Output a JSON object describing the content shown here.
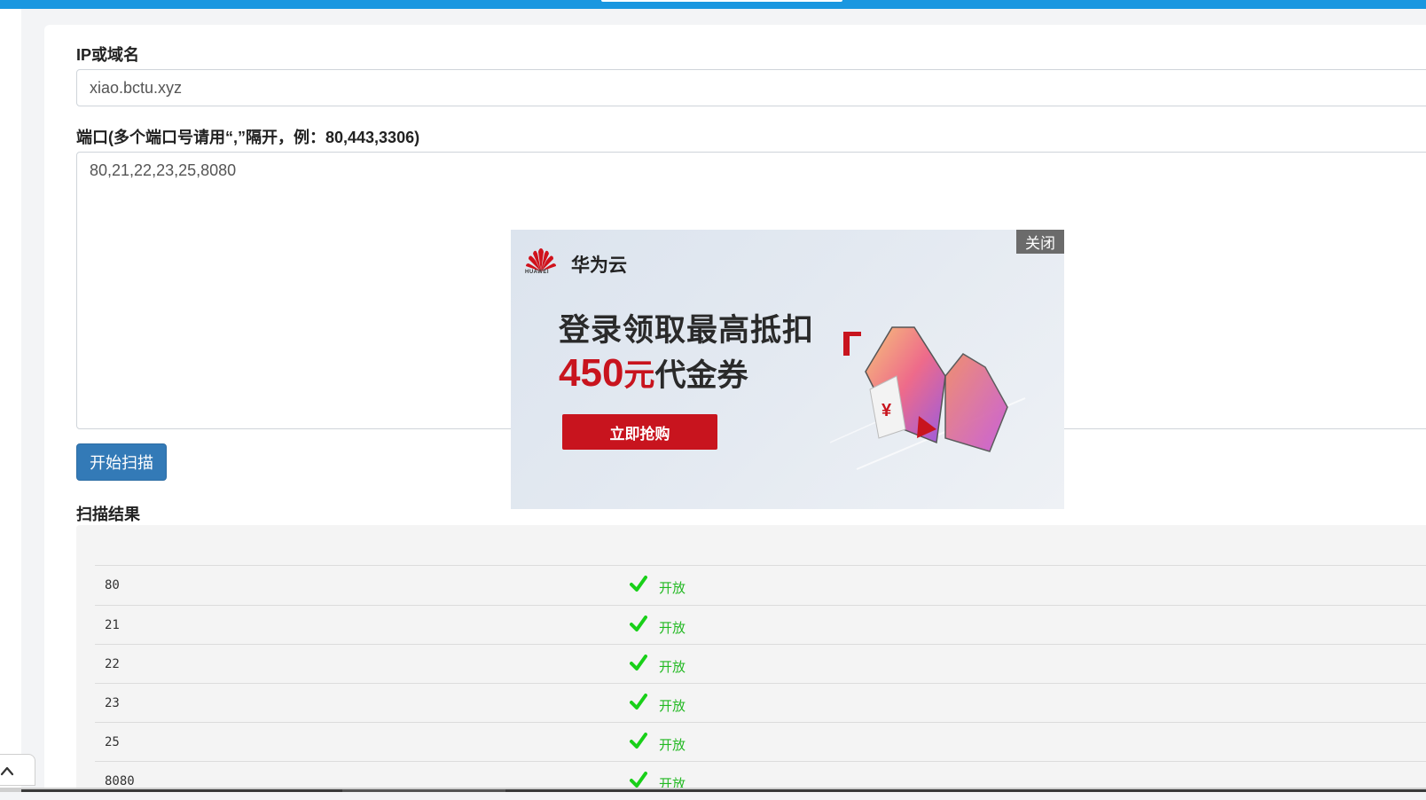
{
  "form": {
    "host_label": "IP或域名",
    "host_value": "xiao.bctu.xyz",
    "ports_label": "端口(多个端口号请用“,”隔开，例：80,443,3306)",
    "ports_value": "80,21,22,23,25,8080",
    "scan_button": "开始扫描",
    "results_label": "扫描结果"
  },
  "results": [
    {
      "port": "80",
      "status": "开放"
    },
    {
      "port": "21",
      "status": "开放"
    },
    {
      "port": "22",
      "status": "开放"
    },
    {
      "port": "23",
      "status": "开放"
    },
    {
      "port": "25",
      "status": "开放"
    },
    {
      "port": "8080",
      "status": "开放"
    }
  ],
  "ad": {
    "close_label": "关闭",
    "brand": "华为云",
    "logo_word": "HUAWEI",
    "headline": "登录领取最高抵扣",
    "amount": "450",
    "amount_unit": "元",
    "amount_suffix": "代金券",
    "cta": "立即抢购"
  },
  "colors": {
    "topbar": "#1a97e0",
    "button": "#337ab7",
    "open_status": "#22b922",
    "ad_red": "#c8141e"
  },
  "icons": {
    "check": "check-icon",
    "scroll_top": "chevron-up-icon",
    "logo": "huawei-logo-icon"
  }
}
